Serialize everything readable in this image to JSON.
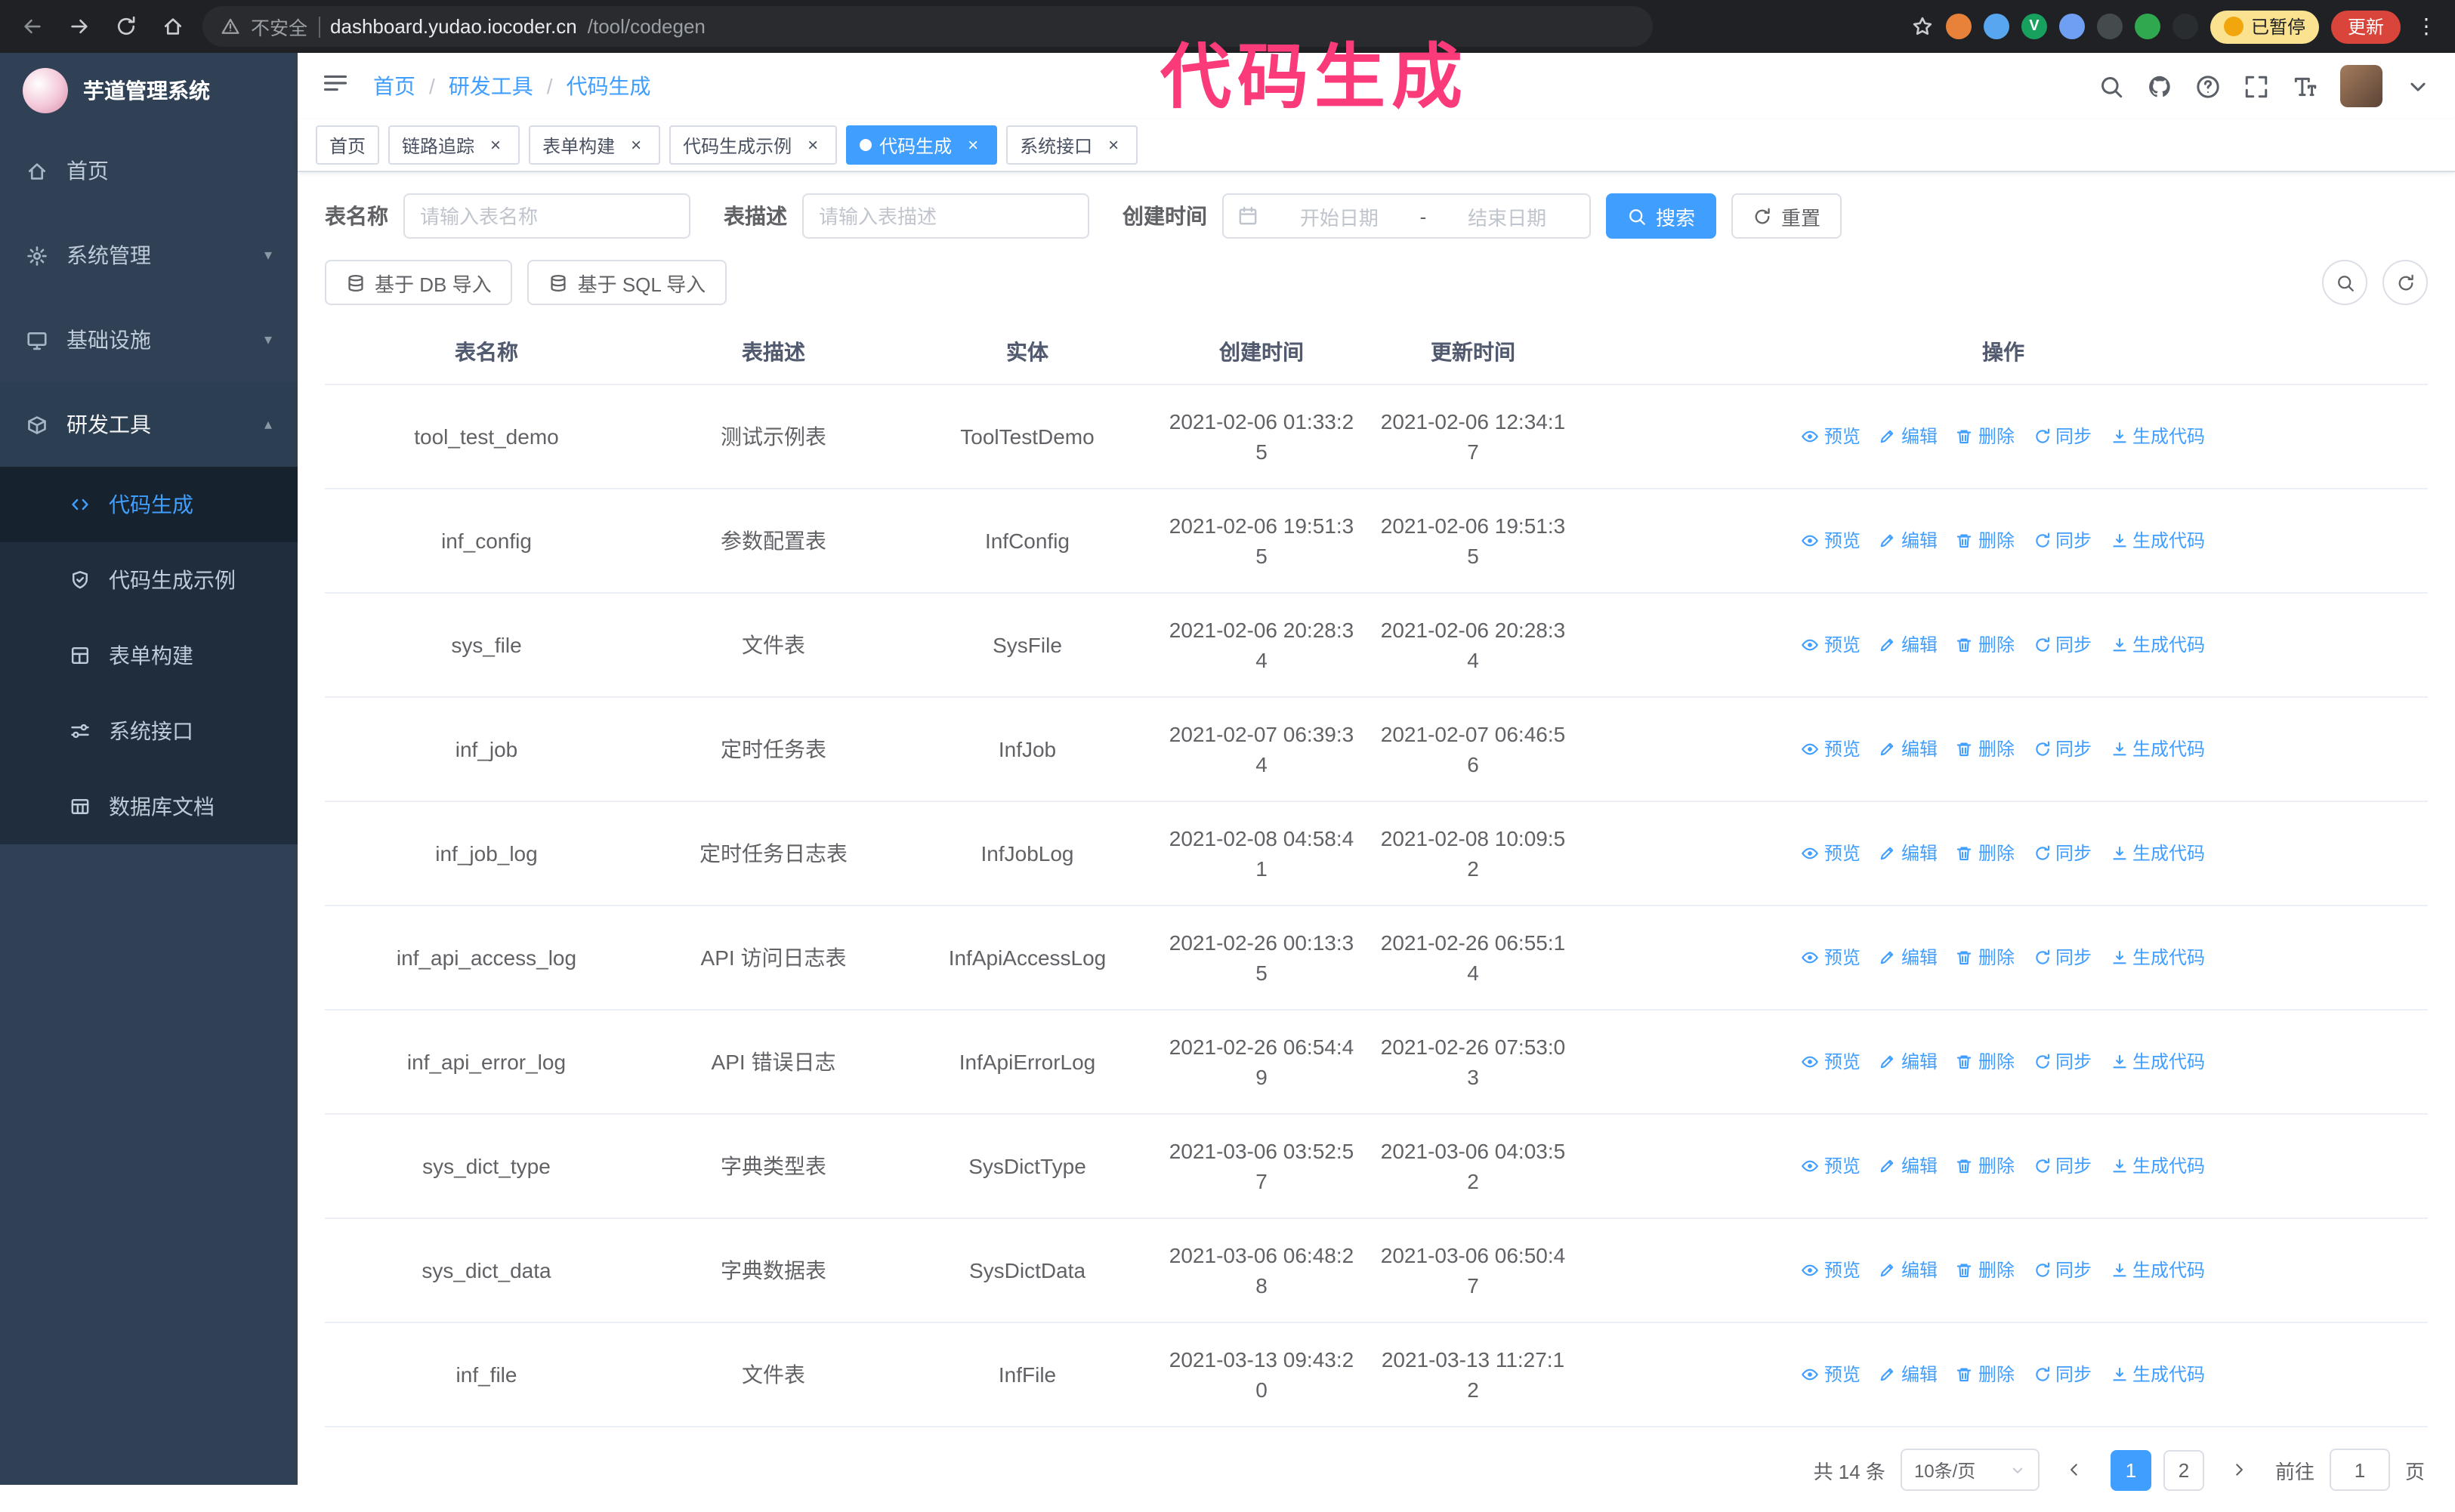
{
  "colors": {
    "accent": "#409eff",
    "sidebar_bg": "#304156",
    "submenu_bg": "#1f2d3d",
    "annotation_pink": "#fb3a7a",
    "update_red": "#d9453a",
    "paused_yellow": "#fbe290"
  },
  "browser": {
    "security_label": "不安全",
    "url_host": "dashboard.yudao.iocoder.cn",
    "url_path": "/tool/codegen",
    "paused_label": "已暂停",
    "update_label": "更新",
    "extensions": [
      {
        "name": "extension-icon-orange",
        "color": "#e8823a"
      },
      {
        "name": "extension-icon-blue",
        "color": "#58a6f0"
      },
      {
        "name": "extension-icon-green-v",
        "color": "#18a05e",
        "glyph": "V"
      },
      {
        "name": "extension-icon-people",
        "color": "#6f9ff2"
      },
      {
        "name": "extension-icon-dark",
        "color": "#454a4d"
      },
      {
        "name": "extension-icon-leaf",
        "color": "#2fa84f"
      },
      {
        "name": "extension-icon-pin",
        "color": "#2a2d30"
      }
    ]
  },
  "annotation": {
    "text": "代码生成"
  },
  "sidebar": {
    "logo_title": "芋道管理系统",
    "menu": [
      {
        "label": "首页",
        "icon": "home",
        "type": "leaf",
        "state": "none"
      },
      {
        "label": "系统管理",
        "icon": "gear",
        "type": "group",
        "state": "collapsed"
      },
      {
        "label": "基础设施",
        "icon": "infra",
        "type": "group",
        "state": "collapsed"
      },
      {
        "label": "研发工具",
        "icon": "tools",
        "type": "group",
        "state": "expanded"
      }
    ],
    "submenu": [
      {
        "label": "代码生成",
        "icon": "code",
        "active": true
      },
      {
        "label": "代码生成示例",
        "icon": "shield",
        "active": false
      },
      {
        "label": "表单构建",
        "icon": "form",
        "active": false
      },
      {
        "label": "系统接口",
        "icon": "api",
        "active": false
      },
      {
        "label": "数据库文档",
        "icon": "dbdoc",
        "active": false
      }
    ]
  },
  "header": {
    "breadcrumb": [
      "首页",
      "研发工具",
      "代码生成"
    ]
  },
  "tabs": [
    {
      "label": "首页",
      "closable": false,
      "active": false
    },
    {
      "label": "链路追踪",
      "closable": true,
      "active": false
    },
    {
      "label": "表单构建",
      "closable": true,
      "active": false
    },
    {
      "label": "代码生成示例",
      "closable": true,
      "active": false
    },
    {
      "label": "代码生成",
      "closable": true,
      "active": true
    },
    {
      "label": "系统接口",
      "closable": true,
      "active": false
    }
  ],
  "filters": {
    "table_name_label": "表名称",
    "table_name_placeholder": "请输入表名称",
    "table_desc_label": "表描述",
    "table_desc_placeholder": "请输入表描述",
    "create_time_label": "创建时间",
    "date_start_placeholder": "开始日期",
    "date_separator": "-",
    "date_end_placeholder": "结束日期",
    "search_label": "搜索",
    "reset_label": "重置"
  },
  "toolbar": {
    "import_db_label": "基于 DB 导入",
    "import_sql_label": "基于 SQL 导入"
  },
  "table": {
    "columns": [
      "表名称",
      "表描述",
      "实体",
      "创建时间",
      "更新时间",
      "操作"
    ],
    "actions": [
      "预览",
      "编辑",
      "删除",
      "同步",
      "生成代码"
    ],
    "rows": [
      {
        "name": "tool_test_demo",
        "desc": "测试示例表",
        "entity": "ToolTestDemo",
        "created": "2021-02-06 01:33:25",
        "updated": "2021-02-06 12:34:17"
      },
      {
        "name": "inf_config",
        "desc": "参数配置表",
        "entity": "InfConfig",
        "created": "2021-02-06 19:51:35",
        "updated": "2021-02-06 19:51:35"
      },
      {
        "name": "sys_file",
        "desc": "文件表",
        "entity": "SysFile",
        "created": "2021-02-06 20:28:34",
        "updated": "2021-02-06 20:28:34"
      },
      {
        "name": "inf_job",
        "desc": "定时任务表",
        "entity": "InfJob",
        "created": "2021-02-07 06:39:34",
        "updated": "2021-02-07 06:46:56"
      },
      {
        "name": "inf_job_log",
        "desc": "定时任务日志表",
        "entity": "InfJobLog",
        "created": "2021-02-08 04:58:41",
        "updated": "2021-02-08 10:09:52"
      },
      {
        "name": "inf_api_access_log",
        "desc": "API 访问日志表",
        "entity": "InfApiAccessLog",
        "created": "2021-02-26 00:13:35",
        "updated": "2021-02-26 06:55:14"
      },
      {
        "name": "inf_api_error_log",
        "desc": "API 错误日志",
        "entity": "InfApiErrorLog",
        "created": "2021-02-26 06:54:49",
        "updated": "2021-02-26 07:53:03"
      },
      {
        "name": "sys_dict_type",
        "desc": "字典类型表",
        "entity": "SysDictType",
        "created": "2021-03-06 03:52:57",
        "updated": "2021-03-06 04:03:52"
      },
      {
        "name": "sys_dict_data",
        "desc": "字典数据表",
        "entity": "SysDictData",
        "created": "2021-03-06 06:48:28",
        "updated": "2021-03-06 06:50:47"
      },
      {
        "name": "inf_file",
        "desc": "文件表",
        "entity": "InfFile",
        "created": "2021-03-13 09:43:20",
        "updated": "2021-03-13 11:27:12"
      }
    ]
  },
  "pagination": {
    "total_label": "共 14 条",
    "page_size_label": "10条/页",
    "pages": [
      "1",
      "2"
    ],
    "active_page": "1",
    "goto_label": "前往",
    "goto_value": "1",
    "unit_label": "页"
  }
}
